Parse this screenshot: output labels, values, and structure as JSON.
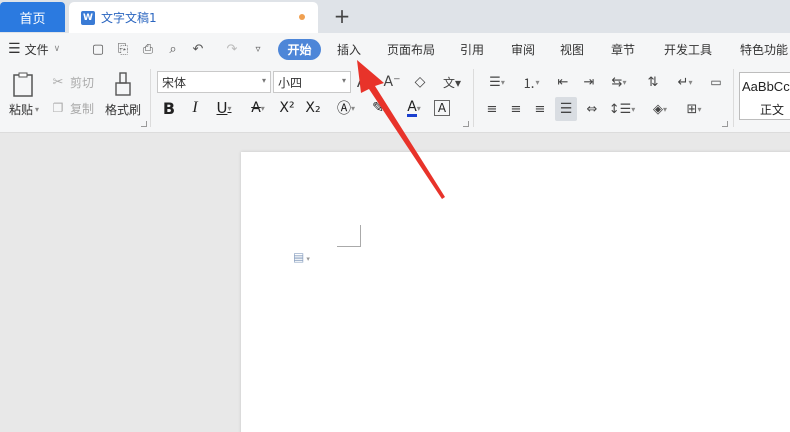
{
  "tabs": {
    "home": "首页",
    "document": "文字文稿1",
    "doc_icon": "W"
  },
  "menu": {
    "file": "文件",
    "start": "开始",
    "items": [
      "插入",
      "页面布局",
      "引用",
      "审阅",
      "视图",
      "章节",
      "开发工具",
      "特色功能"
    ]
  },
  "ribbon": {
    "paste": "粘贴",
    "cut": "剪切",
    "copy": "复制",
    "format_painter": "格式刷",
    "font_name": "宋体",
    "font_size": "小四",
    "style_sample": "AaBbCcDd",
    "style_name": "正文"
  },
  "colors": {
    "accent": "#2b7ae0",
    "start_button": "#4d86d8",
    "annotation_arrow": "#e8332a"
  }
}
